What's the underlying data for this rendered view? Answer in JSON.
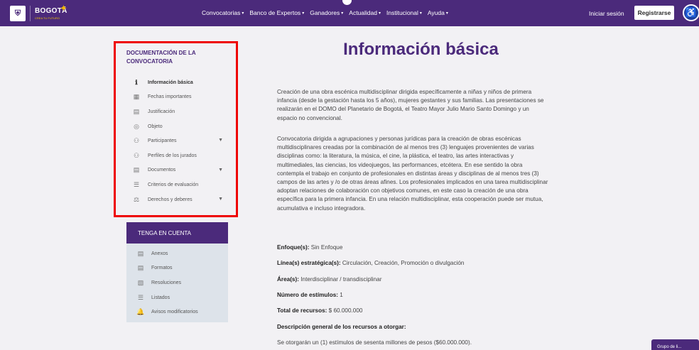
{
  "header": {
    "brand": "BOGOTÁ",
    "brand_sub": "CREA TU FUTURO",
    "nav": [
      {
        "label": "Convocatorias"
      },
      {
        "label": "Banco de Expertos"
      },
      {
        "label": "Ganadores"
      },
      {
        "label": "Actualidad"
      },
      {
        "label": "Institucional"
      },
      {
        "label": "Ayuda"
      }
    ],
    "login_label": "Iniciar sesión",
    "register_label": "Registrarse"
  },
  "sidebar": {
    "title": "Documentación de la convocatoria",
    "items": [
      {
        "label": "Información básica",
        "icon": "info-icon",
        "active": true
      },
      {
        "label": "Fechas importantes",
        "icon": "calendar-icon"
      },
      {
        "label": "Justificación",
        "icon": "document-icon"
      },
      {
        "label": "Objeto",
        "icon": "target-icon"
      },
      {
        "label": "Participantes",
        "icon": "users-icon",
        "expandable": true
      },
      {
        "label": "Perfiles de los jurados",
        "icon": "group-icon"
      },
      {
        "label": "Documentos",
        "icon": "file-icon",
        "expandable": true
      },
      {
        "label": "Criterios de evaluación",
        "icon": "list-icon"
      },
      {
        "label": "Derechos y deberes",
        "icon": "balance-icon",
        "expandable": true
      }
    ]
  },
  "tenga": {
    "title": "Tenga en cuenta",
    "items": [
      {
        "label": "Anexos",
        "icon": "attachment-icon"
      },
      {
        "label": "Formatos",
        "icon": "form-icon"
      },
      {
        "label": "Resoluciones",
        "icon": "resolution-icon"
      },
      {
        "label": "Listados",
        "icon": "list-icon"
      },
      {
        "label": "Avisos modificatorios",
        "icon": "bell-icon"
      }
    ]
  },
  "main": {
    "title": "Información básica",
    "paragraph1": "Creación de una obra escénica multidisciplinar dirigida específicamente a niñas y niños de primera infancia (desde la gestación hasta los 5 años), mujeres gestantes y sus familias. Las presentaciones se realizarán en el DOMO del Planetario de Bogotá, el Teatro Mayor Julio Mario Santo Domingo y un espacio no convencional.",
    "paragraph2": "Convocatoria dirigida a agrupaciones y personas jurídicas para la creación de obras escénicas multidisciplinares creadas por la combinación de al menos tres (3) lenguajes provenientes de varias disciplinas como: la literatura, la música, el cine, la plástica, el teatro, las artes interactivas y multimediales, las ciencias, los videojuegos, las performances, etcétera. En ese sentido la obra contempla el trabajo en conjunto de profesionales en distintas áreas y disciplinas de al menos tres (3) campos de las artes y /o de otras áreas afines. Los profesionales implicados en una tarea multidisciplinar adoptan relaciones de colaboración con objetivos comunes, en este caso la creación de una obra específica para la primera infancia. En una relación multidisciplinar, esta cooperación puede ser mutua, acumulativa e incluso integradora.",
    "enfoque_label": "Enfoque(s):",
    "enfoque_value": "Sin Enfoque",
    "linea_label": "Línea(s) estratégica(s):",
    "linea_value": "Circulación, Creación, Promoción o divulgación",
    "area_label": "Área(s):",
    "area_value": "Interdisciplinar / transdisciplinar",
    "estimulos_label": "Número de estímulos:",
    "estimulos_value": "1",
    "recursos_label": "Total de recursos:",
    "recursos_value": "$ 60.000.000",
    "descripcion_label": "Descripción general de los recursos a otorgar:",
    "descripcion_value": "Se otorgarán un (1) estímulos de sesenta millones de pesos ($60.000.000).",
    "corner_label": "Grupo de li..."
  },
  "colors": {
    "brand": "#4b2a7b",
    "highlight": "#ee0000"
  }
}
